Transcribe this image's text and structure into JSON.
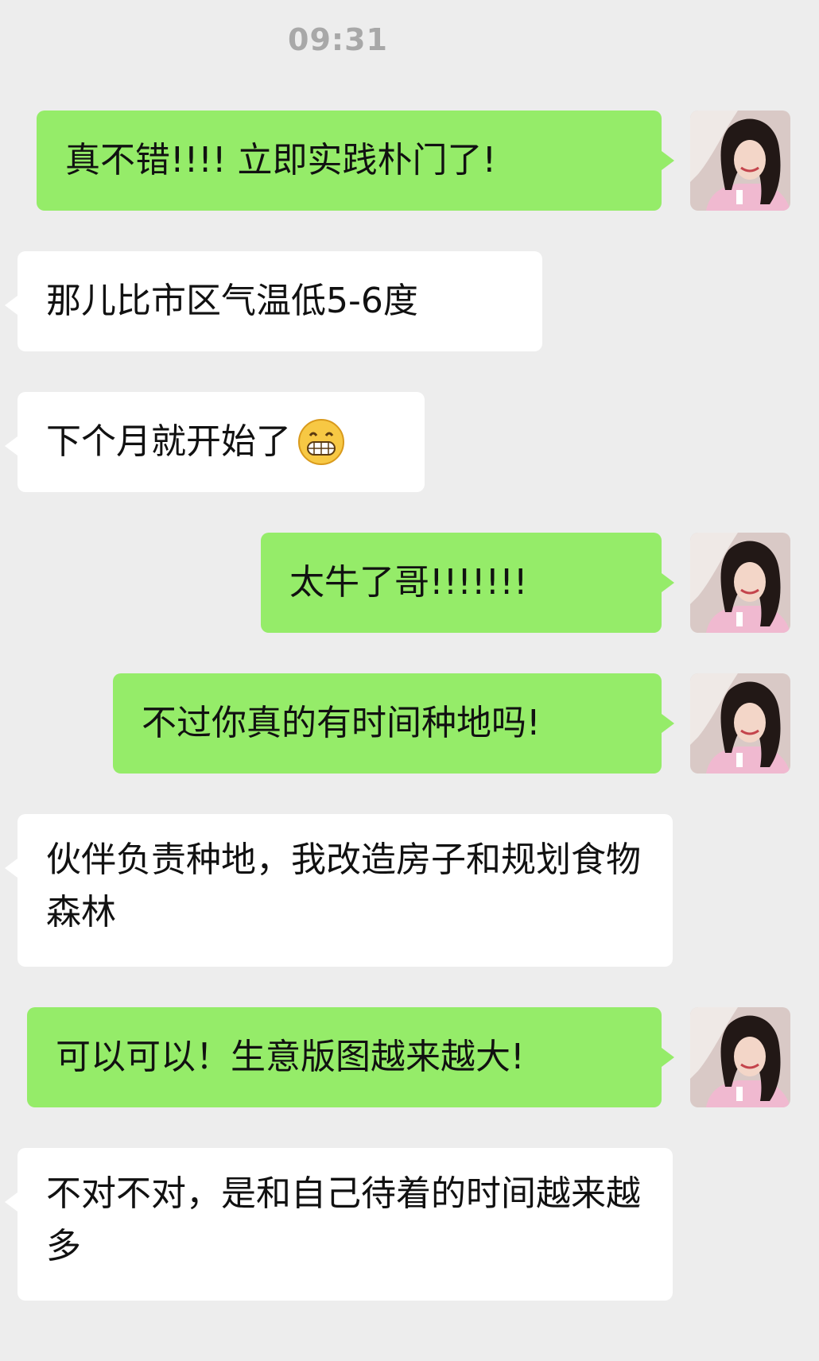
{
  "status": {
    "time": "09:31"
  },
  "messages": [
    {
      "side": "sent",
      "text": "真不错!!!! 立即实践朴门了!"
    },
    {
      "side": "received",
      "text": "那儿比市区气温低5-6度"
    },
    {
      "side": "received",
      "text": "下个月就开始了",
      "emoji": "grinning-face-emoji"
    },
    {
      "side": "sent",
      "text": "太牛了哥!!!!!!!"
    },
    {
      "side": "sent",
      "text": "不过你真的有时间种地吗!"
    },
    {
      "side": "received",
      "text": "伙伴负责种地，我改造房子和规划食物森林"
    },
    {
      "side": "sent",
      "text": "可以可以！生意版图越来越大!"
    },
    {
      "side": "received",
      "text": "不对不对，是和自己待着的时间越来越多"
    }
  ],
  "colors": {
    "background": "#ededed",
    "sent_bubble": "#95ec69",
    "received_bubble": "#ffffff",
    "timestamp": "#a8a8a8"
  }
}
